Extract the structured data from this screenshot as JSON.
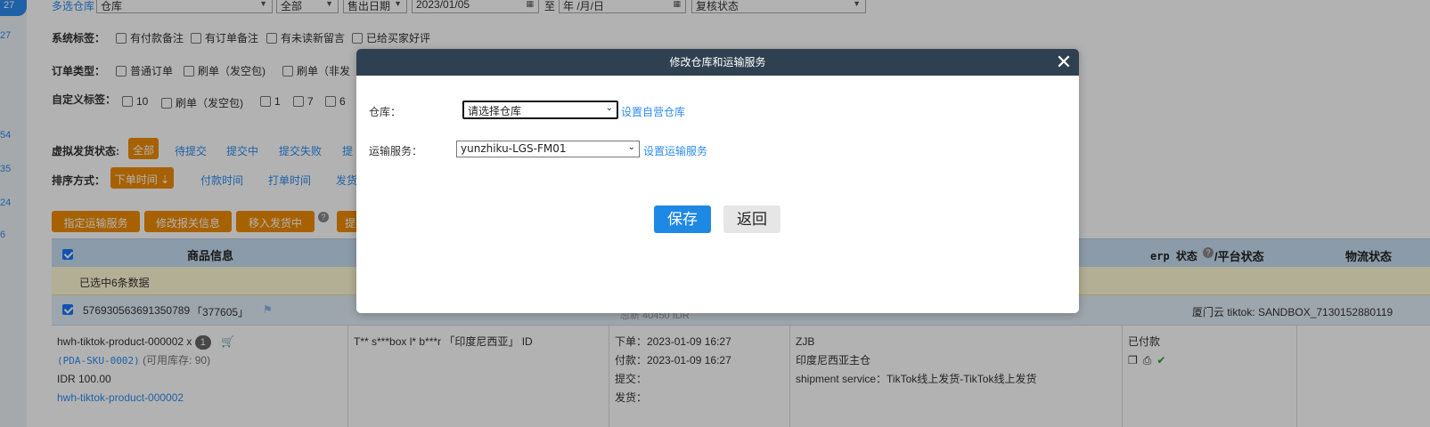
{
  "left_nav": {
    "tab_label": "27",
    "numbers": [
      "27",
      "54",
      "35",
      "24",
      "6"
    ]
  },
  "filters": {
    "row1": {
      "label": "多选仓库",
      "warehouse_select": "仓库",
      "all_select": "全部",
      "date_type_select": "售出日期",
      "date_from": "2023/01/05",
      "to_label": "至",
      "date_to_placeholder": "年 /月/日",
      "review_select": "复核状态"
    },
    "system_tags": {
      "label": "系统标签：",
      "options": [
        "有付款备注",
        "有订单备注",
        "有未读新留言",
        "已给买家好评"
      ]
    },
    "order_types": {
      "label": "订单类型：",
      "options": [
        "普通订单",
        "刷单（发空包)",
        "刷单（非发"
      ]
    },
    "custom_tags": {
      "label": "自定义标签：",
      "options": [
        "10",
        "刷单（发空包)",
        "1",
        "7",
        "6"
      ]
    },
    "virtual_status": {
      "label": "虚拟发货状态:",
      "active": "全部",
      "items": [
        "待提交",
        "提交中",
        "提交失败",
        "提"
      ]
    },
    "sort": {
      "label": "排序方式：",
      "active": "下单时间",
      "items": [
        "付款时间",
        "打单时间",
        "发货"
      ]
    }
  },
  "actions": {
    "buttons": [
      "指定运输服务",
      "修改报关信息",
      "移入发货中",
      "提"
    ]
  },
  "table": {
    "headers": {
      "product_info": "商品信息",
      "erp_status": "erp 状态",
      "platform_status": "/平台状态",
      "logistics_status": "物流状态"
    },
    "selected_text": "已选中6条数据",
    "order": {
      "order_no": "576930563691350789",
      "order_tag": "「377605」",
      "partial_text": "忽新 40450 IDR",
      "shop": "厦门云 tiktok: SANDBOX_7130152880119"
    },
    "product": {
      "title": "hwh-tiktok-product-000002 x",
      "qty": "1",
      "sku": "(PDA-SKU-0002)",
      "stock": "(可用库存: 90)",
      "price": "IDR 100.00",
      "link": "hwh-tiktok-product-000002"
    },
    "buyer": "T** s***box l* b***r 「印度尼西亚」 ID",
    "times": {
      "order_time": "下单：2023-01-09 16:27",
      "pay_time": "付款：2023-01-09 16:27",
      "submit": "提交：",
      "ship": "发货："
    },
    "warehouse_info": {
      "code": "ZJB",
      "warehouse": "印度尼西亚主仓",
      "shipment": "shipment service：TikTok线上发货-TikTok线上发货"
    },
    "status": "已付款"
  },
  "modal": {
    "title": "修改仓库和运输服务",
    "close": "✕",
    "warehouse_label": "仓库：",
    "warehouse_value": "请选择仓库",
    "warehouse_link": "设置自营仓库",
    "shipping_label": "运输服务：",
    "shipping_value": "yunzhiku-LGS-FM01",
    "shipping_link": "设置运输服务",
    "save": "保存",
    "back": "返回"
  },
  "colors": {
    "accent": "#2d8cf0",
    "orange": "#f08c00",
    "modal_header": "#2f4050",
    "save": "#1e88e5"
  }
}
